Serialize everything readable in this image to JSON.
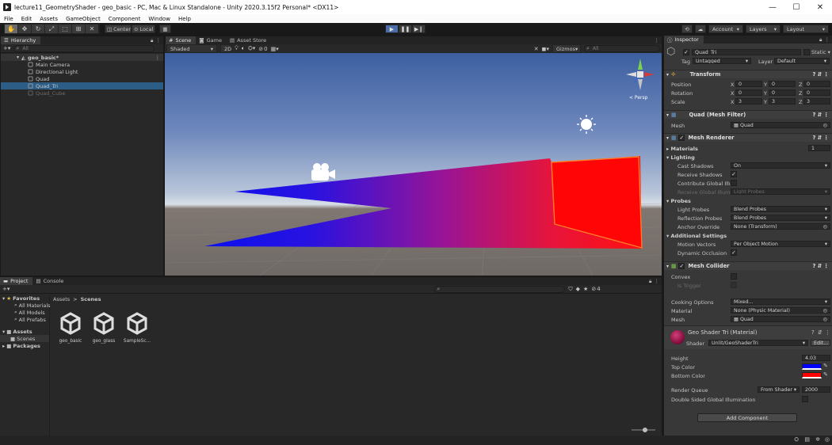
{
  "window": {
    "title": "lecture11_GeometryShader - geo_basic - PC, Mac & Linux Standalone - Unity 2020.3.15f2 Personal* <DX11>",
    "min": "—",
    "max": "☐",
    "close": "✕"
  },
  "menu": [
    "File",
    "Edit",
    "Assets",
    "GameObject",
    "Component",
    "Window",
    "Help"
  ],
  "toolbar": {
    "center": "Center",
    "local": "Local",
    "account": "Account",
    "layers": "Layers",
    "layout": "Layout"
  },
  "hierarchy": {
    "tab": "Hierarchy",
    "search": "All",
    "scene": "geo_basic*",
    "items": [
      "Main Camera",
      "Directional Light",
      "Quad",
      "Quad_Tri",
      "Quad_Cube"
    ]
  },
  "scene": {
    "tabs": [
      "Scene",
      "Game",
      "Asset Store"
    ],
    "shading": "Shaded",
    "mode2d": "2D",
    "gizmos": "Gizmos",
    "search": "All",
    "persp": "< Persp",
    "fx_count": "0"
  },
  "inspector": {
    "tab": "Inspector",
    "object_name": "Quad_Tri",
    "static": "Static",
    "tag_label": "Tag",
    "tag": "Untagged",
    "layer_label": "Layer",
    "layer": "Default",
    "transform": {
      "title": "Transform",
      "position_label": "Position",
      "rotation_label": "Rotation",
      "scale_label": "Scale",
      "position": [
        "0",
        "0",
        "0"
      ],
      "rotation": [
        "0",
        "0",
        "0"
      ],
      "scale": [
        "3",
        "3",
        "3"
      ],
      "axes": [
        "X",
        "Y",
        "Z"
      ]
    },
    "mesh_filter": {
      "title": "Quad (Mesh Filter)",
      "mesh_label": "Mesh",
      "mesh": "Quad"
    },
    "mesh_renderer": {
      "title": "Mesh Renderer",
      "materials": "Materials",
      "materials_count": "1",
      "lighting": "Lighting",
      "cast_shadows_label": "Cast Shadows",
      "cast_shadows": "On",
      "receive_shadows_label": "Receive Shadows",
      "contribute_gi_label": "Contribute Global Illu",
      "receive_gi_label": "Receive Global Illumi",
      "receive_gi": "Light Probes",
      "probes": "Probes",
      "light_probes_label": "Light Probes",
      "light_probes": "Blend Probes",
      "reflection_probes_label": "Reflection Probes",
      "reflection_probes": "Blend Probes",
      "anchor_label": "Anchor Override",
      "anchor": "None (Transform)",
      "additional": "Additional Settings",
      "motion_label": "Motion Vectors",
      "motion": "Per Object Motion",
      "dynamic_occ_label": "Dynamic Occlusion"
    },
    "mesh_collider": {
      "title": "Mesh Collider",
      "convex_label": "Convex",
      "trigger_label": "Is Trigger",
      "cooking_label": "Cooking Options",
      "cooking": "Mixed...",
      "material_label": "Material",
      "material": "None (Physic Material)",
      "mesh_label": "Mesh",
      "mesh": "Quad"
    },
    "material": {
      "title": "Geo Shader Tri (Material)",
      "shader_label": "Shader",
      "shader": "Unlit/GeoShaderTri",
      "edit": "Edit...",
      "height_label": "Height",
      "height": "4.03",
      "top_color_label": "Top Color",
      "top_color": "#0000ff",
      "bottom_color_label": "Bottom Color",
      "bottom_color": "#ff0000",
      "render_queue_label": "Render Queue",
      "render_queue_mode": "From Shader",
      "render_queue": "2000",
      "dsgi_label": "Double Sided Global Illumination"
    },
    "add_component": "Add Component"
  },
  "project": {
    "tabs": [
      "Project",
      "Console"
    ],
    "favorites": "Favorites",
    "fav_items": [
      "All Materials",
      "All Models",
      "All Prefabs"
    ],
    "assets": "Assets",
    "scenes": "Scenes",
    "packages": "Packages",
    "breadcrumb": [
      "Assets",
      "Scenes"
    ],
    "hidden_count": "4",
    "files": [
      "geo_basic",
      "geo_glass",
      "SampleSc..."
    ]
  }
}
